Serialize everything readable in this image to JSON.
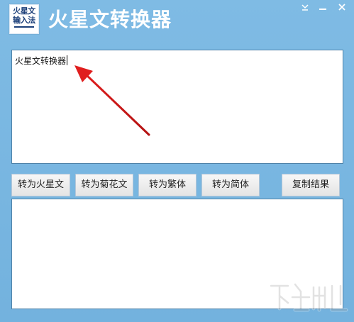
{
  "app": {
    "logo_line1": "火星文",
    "logo_line2": "输入法",
    "title": "火星文转换器"
  },
  "window_controls": {
    "icons": [
      "chevron-down-icon",
      "minimize-icon",
      "close-icon"
    ]
  },
  "input": {
    "value": "火星文转换器"
  },
  "buttons": {
    "to_martian": "转为火星文",
    "to_chrysanthemum": "转为菊花文",
    "to_traditional": "转为繁体",
    "to_simplified": "转为简体",
    "copy_result": "复制结果"
  },
  "output": {
    "value": ""
  },
  "colors": {
    "background": "#78b6e0",
    "arrow": "#e01e1e",
    "logo_text": "#1b3f79"
  }
}
